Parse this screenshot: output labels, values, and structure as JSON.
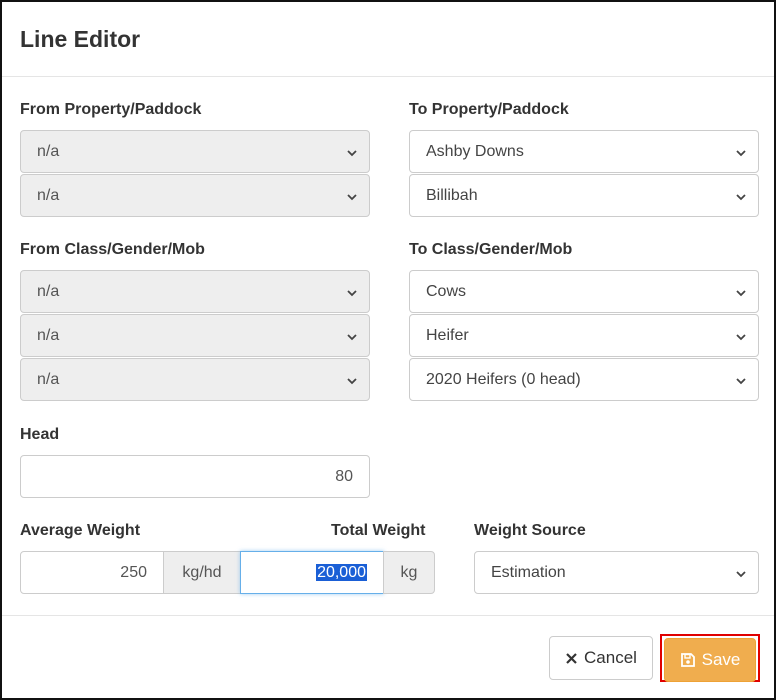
{
  "dialog": {
    "title": "Line Editor"
  },
  "from_property": {
    "label": "From Property/Paddock",
    "property": "n/a",
    "paddock": "n/a"
  },
  "to_property": {
    "label": "To Property/Paddock",
    "property": "Ashby Downs",
    "paddock": "Billibah"
  },
  "from_class": {
    "label": "From Class/Gender/Mob",
    "class": "n/a",
    "gender": "n/a",
    "mob": "n/a"
  },
  "to_class": {
    "label": "To Class/Gender/Mob",
    "class": "Cows",
    "gender": "Heifer",
    "mob": "2020 Heifers (0 head)"
  },
  "head": {
    "label": "Head",
    "value": "80"
  },
  "average_weight": {
    "label": "Average Weight",
    "value": "250",
    "unit": "kg/hd"
  },
  "total_weight": {
    "label": "Total Weight",
    "value": "20,000",
    "unit": "kg"
  },
  "weight_source": {
    "label": "Weight Source",
    "value": "Estimation"
  },
  "footer": {
    "cancel_label": "Cancel",
    "save_label": "Save"
  },
  "colors": {
    "save_bg": "#f0ad4e",
    "highlight": "#1a5fd6",
    "disabled_bg": "#eeeeee",
    "focus_border": "#66afe9",
    "save_outline": "#e00000"
  },
  "icons": {
    "cancel": "close-icon",
    "save": "floppy-disk-icon",
    "select": "chevron-down-icon"
  }
}
